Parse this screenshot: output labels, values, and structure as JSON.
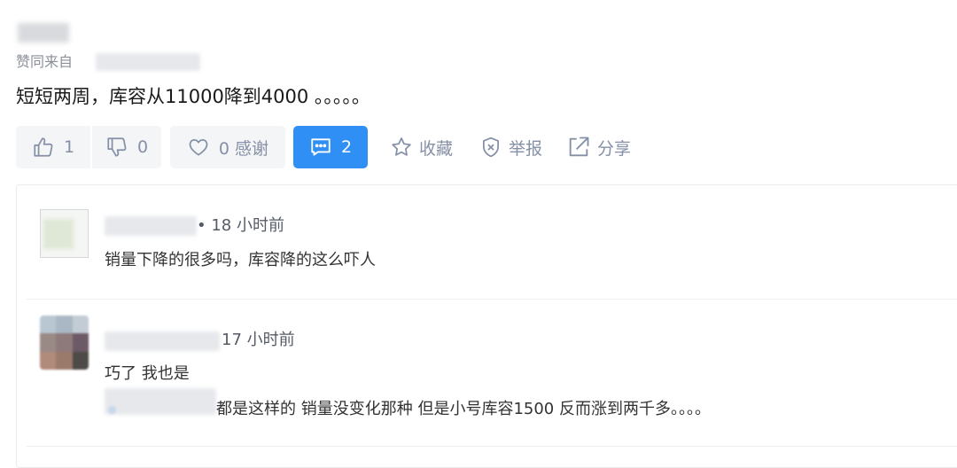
{
  "answer": {
    "via_label": "赞同来自",
    "content": "短短两周，库容从11000降到4000 。。。。。"
  },
  "actions": {
    "upvote": {
      "count": "1",
      "icon": "thumbs-up-icon"
    },
    "downvote": {
      "count": "0",
      "icon": "thumbs-down-icon"
    },
    "thanks": {
      "label": "0 感谢",
      "icon": "heart-icon"
    },
    "comments": {
      "count": "2",
      "icon": "comment-icon"
    },
    "collect": {
      "label": "收藏",
      "icon": "star-icon"
    },
    "report": {
      "label": "举报",
      "icon": "shield-icon"
    },
    "share": {
      "label": "分享",
      "icon": "share-icon"
    }
  },
  "comments": [
    {
      "time": "• 18 小时前",
      "text": "销量下降的很多吗，库容降的这么吓人"
    },
    {
      "time": "17 小时前",
      "text": "巧了 我也是",
      "reply_text": "都是这样的 销量没变化那种 但是小号库容1500 反而涨到两千多。。。。"
    }
  ],
  "colors": {
    "accent": "#2f8ff5",
    "muted": "#8590a6",
    "button_bg": "#f4f5f7"
  }
}
